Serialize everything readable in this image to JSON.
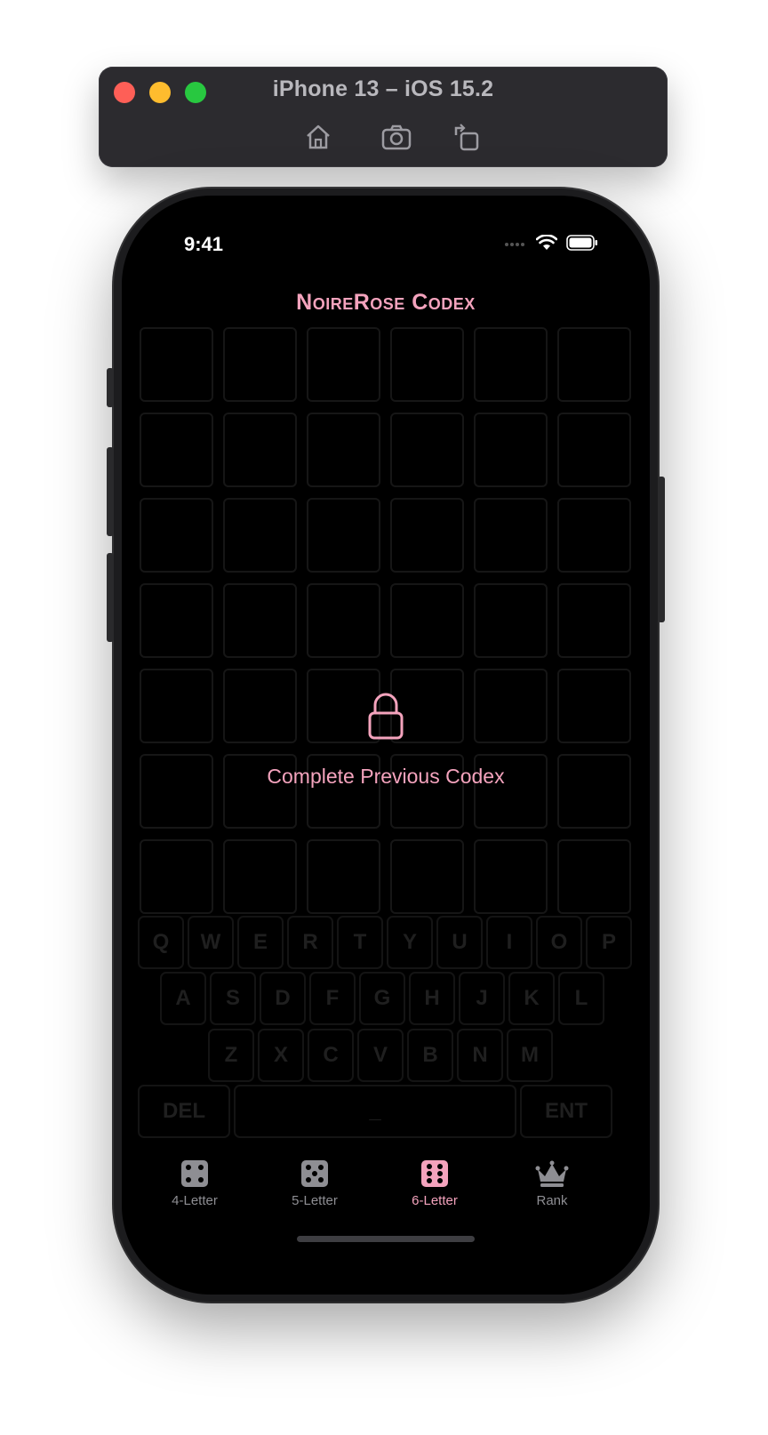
{
  "simulator": {
    "title": "iPhone 13 – iOS 15.2",
    "buttons": [
      "home-icon",
      "screenshot-icon",
      "rotate-icon"
    ],
    "traffic_colors": {
      "close": "#fe5f57",
      "minimize": "#febc2e",
      "zoom": "#28c840"
    }
  },
  "status_bar": {
    "time": "9:41"
  },
  "app": {
    "title": "NoireRose Codex",
    "accent": "#f4a3bd",
    "grid": {
      "rows": 7,
      "columns": 6
    },
    "locked_message": "Complete Previous Codex"
  },
  "keyboard": {
    "row1": [
      "Q",
      "W",
      "E",
      "R",
      "T",
      "Y",
      "U",
      "I",
      "O",
      "P"
    ],
    "row2": [
      "A",
      "S",
      "D",
      "F",
      "G",
      "H",
      "J",
      "K",
      "L"
    ],
    "row3": [
      "Z",
      "X",
      "C",
      "V",
      "B",
      "N",
      "M"
    ],
    "delete_label": "DEL",
    "space_label": "_",
    "enter_label": "ENT"
  },
  "tabs": [
    {
      "label": "4-Letter",
      "icon": "dice-four-icon",
      "active": false
    },
    {
      "label": "5-Letter",
      "icon": "dice-five-icon",
      "active": false
    },
    {
      "label": "6-Letter",
      "icon": "dice-six-icon",
      "active": true
    },
    {
      "label": "Rank",
      "icon": "crown-icon",
      "active": false
    }
  ]
}
